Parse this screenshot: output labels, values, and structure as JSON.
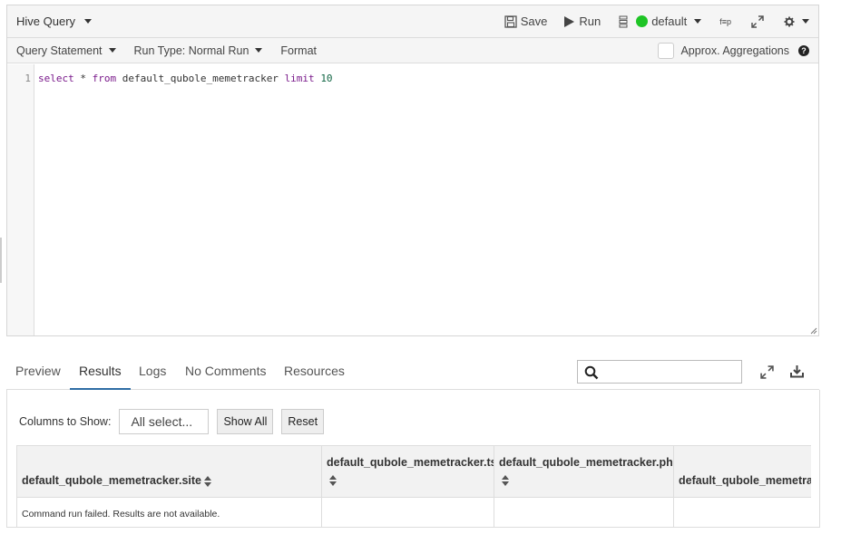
{
  "header": {
    "title": "Hive Query",
    "save_label": "Save",
    "run_label": "Run",
    "cluster_label": "default",
    "cluster_status_color": "#1ec425",
    "format_icon_text": "f≡p"
  },
  "subbar": {
    "query_statement_label": "Query Statement",
    "run_type_label": "Run Type: Normal Run",
    "format_label": "Format",
    "approx_label": "Approx. Aggregations"
  },
  "editor": {
    "line_number": "1",
    "tokens": {
      "select": "select",
      "star": " * ",
      "from": "from",
      "table": " default_qubole_memetracker ",
      "limit": "limit",
      "space": " ",
      "count": "10"
    }
  },
  "tabs": {
    "preview": "Preview",
    "results": "Results",
    "logs": "Logs",
    "comments": "No Comments",
    "resources": "Resources"
  },
  "search": {
    "value": "",
    "placeholder": ""
  },
  "results": {
    "columns_label": "Columns to Show:",
    "columns_select_value": "All select...",
    "show_all_label": "Show All",
    "reset_label": "Reset",
    "headers": [
      "default_qubole_memetracker.site",
      "default_qubole_memetracker.ts",
      "default_qubole_memetracker.phr",
      "default_qubole_memetracker.url"
    ],
    "message": "Command run failed. Results are not available."
  },
  "colors": {
    "accent": "#2e6da4",
    "toolbar_bg": "#f5f5f5"
  }
}
